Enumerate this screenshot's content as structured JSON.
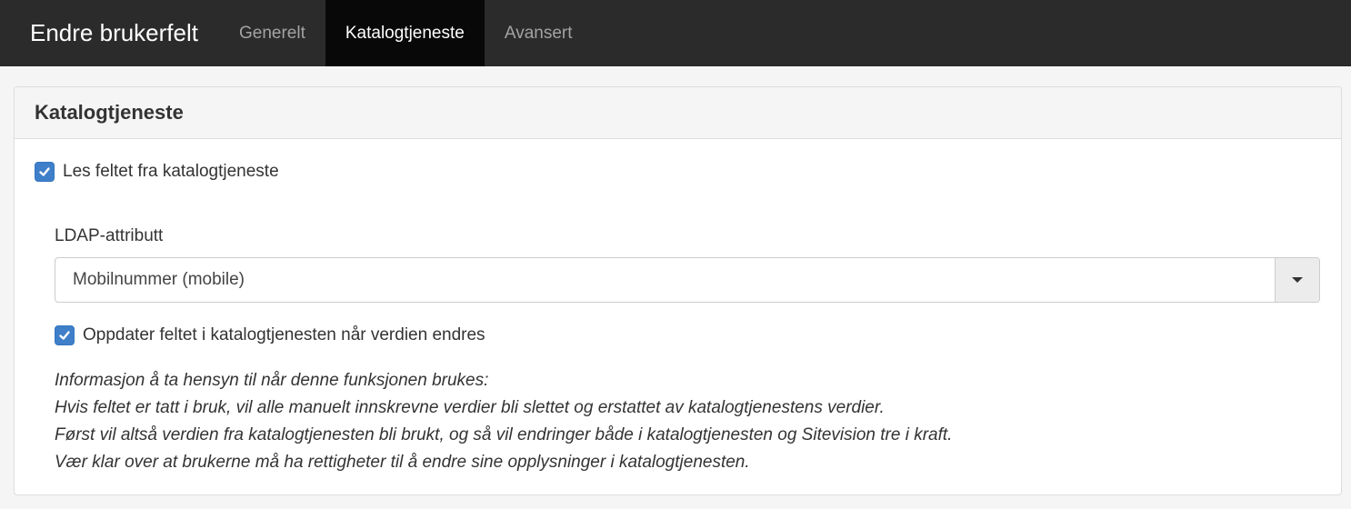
{
  "header": {
    "title": "Endre brukerfelt",
    "tabs": [
      {
        "label": "Generelt",
        "active": false
      },
      {
        "label": "Katalogtjeneste",
        "active": true
      },
      {
        "label": "Avansert",
        "active": false
      }
    ]
  },
  "panel": {
    "heading": "Katalogtjeneste",
    "read_from_directory": {
      "label": "Les feltet fra katalogtjeneste",
      "checked": true
    },
    "ldap_attribute": {
      "label": "LDAP-attributt",
      "selected": "Mobilnummer (mobile)"
    },
    "update_directory": {
      "label": "Oppdater feltet i katalogtjenesten når verdien endres",
      "checked": true
    },
    "info_lines": [
      "Informasjon å ta hensyn til når denne funksjonen brukes:",
      "Hvis feltet er tatt i bruk, vil alle manuelt innskrevne verdier bli slettet og erstattet av katalogtjenestens verdier.",
      "Først vil altså verdien fra katalogtjenesten bli brukt, og så vil endringer både i katalogtjenesten og Sitevision tre i kraft.",
      "Vær klar over at brukerne må ha rettigheter til å endre sine opplysninger i katalogtjenesten."
    ]
  },
  "colors": {
    "topbar": "#2b2b2b",
    "active_tab": "#080808",
    "checkbox": "#3f7fc9"
  }
}
